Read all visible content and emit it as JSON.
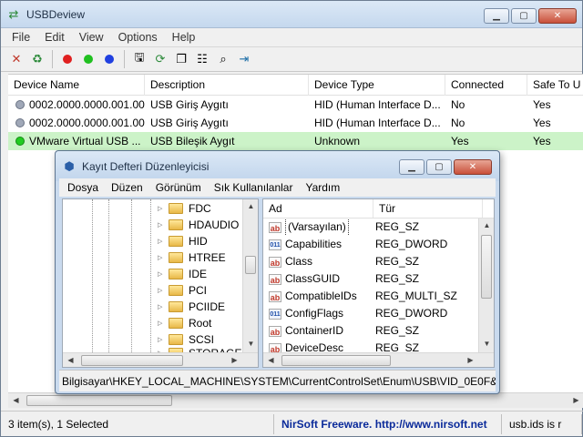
{
  "main": {
    "title": "USBDeview",
    "menu": [
      "File",
      "Edit",
      "View",
      "Options",
      "Help"
    ],
    "columns": [
      "Device Name",
      "Description",
      "Device Type",
      "Connected",
      "Safe To U"
    ],
    "rows": [
      {
        "name": "0002.0000.0000.001.00...",
        "description": "USB Giriş Aygıtı",
        "type": "HID (Human Interface D...",
        "connected": "No",
        "safe": "Yes",
        "status_color": "#a0a8b8"
      },
      {
        "name": "0002.0000.0000.001.00...",
        "description": "USB Giriş Aygıtı",
        "type": "HID (Human Interface D...",
        "connected": "No",
        "safe": "Yes",
        "status_color": "#a0a8b8"
      },
      {
        "name": "VMware Virtual USB ...",
        "description": "USB Bileşik Aygıt",
        "type": "Unknown",
        "connected": "Yes",
        "safe": "Yes",
        "status_color": "#22cc22"
      }
    ],
    "status": {
      "count": "3 item(s), 1 Selected",
      "link": "NirSoft Freeware.  http://www.nirsoft.net",
      "extra": "usb.ids is r"
    }
  },
  "regedit": {
    "title": "Kayıt Defteri Düzenleyicisi",
    "menu": [
      "Dosya",
      "Düzen",
      "Görünüm",
      "Sık Kullanılanlar",
      "Yardım"
    ],
    "tree": [
      "FDC",
      "HDAUDIO",
      "HID",
      "HTREE",
      "IDE",
      "PCI",
      "PCIIDE",
      "Root",
      "SCSI",
      "STORAGE"
    ],
    "columns": [
      "Ad",
      "Tür"
    ],
    "values": [
      {
        "name": "(Varsayılan)",
        "type": "REG_SZ",
        "icon": "ab"
      },
      {
        "name": "Capabilities",
        "type": "REG_DWORD",
        "icon": "bin"
      },
      {
        "name": "Class",
        "type": "REG_SZ",
        "icon": "ab"
      },
      {
        "name": "ClassGUID",
        "type": "REG_SZ",
        "icon": "ab"
      },
      {
        "name": "CompatibleIDs",
        "type": "REG_MULTI_SZ",
        "icon": "ab"
      },
      {
        "name": "ConfigFlags",
        "type": "REG_DWORD",
        "icon": "bin"
      },
      {
        "name": "ContainerID",
        "type": "REG_SZ",
        "icon": "ab"
      },
      {
        "name": "DeviceDesc",
        "type": "REG_SZ",
        "icon": "ab"
      }
    ],
    "status": "Bilgisayar\\HKEY_LOCAL_MACHINE\\SYSTEM\\CurrentControlSet\\Enum\\USB\\VID_0E0F&"
  },
  "icons": {
    "app": "usb-plug-icon",
    "ab_glyph": "ab",
    "bin_glyph": "011"
  }
}
